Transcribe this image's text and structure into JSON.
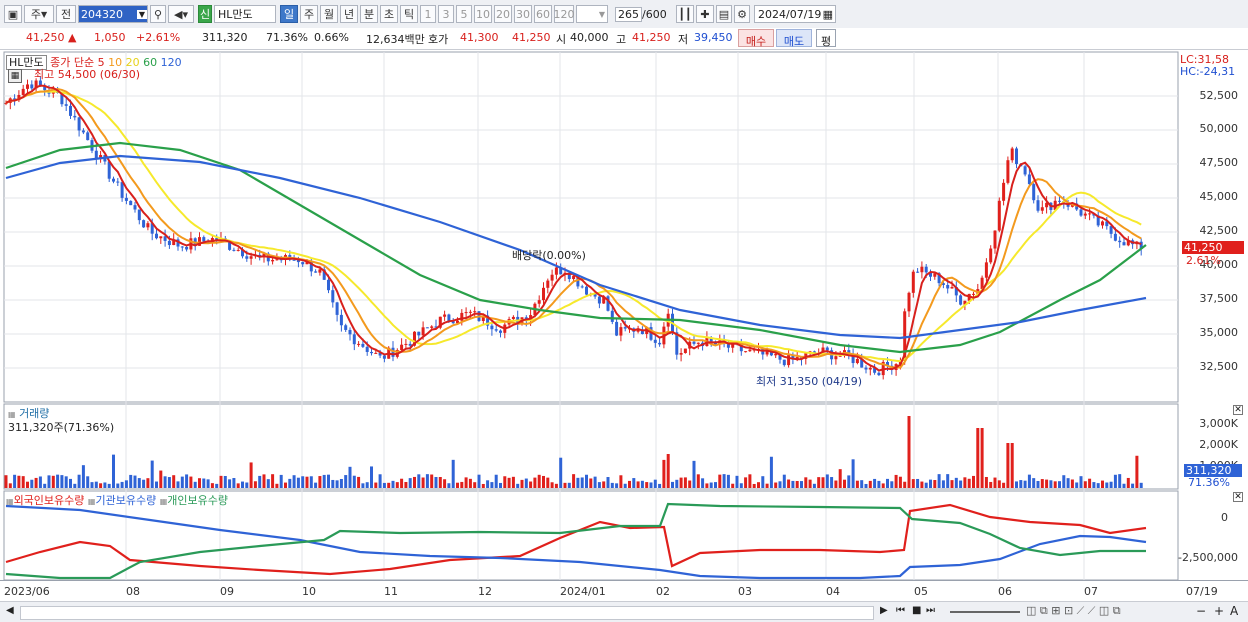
{
  "toolbar": {
    "period_sel": "주",
    "prev_label": "전",
    "stock_code": "204320",
    "new_badge": "신",
    "stock_name": "HL만도",
    "intervals": [
      "일",
      "주",
      "월",
      "년",
      "분",
      "초",
      "틱"
    ],
    "minutes": [
      "1",
      "3",
      "5",
      "10",
      "20",
      "30",
      "60",
      "120"
    ],
    "count_current": "265",
    "count_total": "/600",
    "date": "2024/07/19"
  },
  "quote": {
    "price": "41,250",
    "change": "1,050",
    "change_pct": "+2.61%",
    "volume": "311,320",
    "volume_ratio": "71.36%",
    "turnover": "0.66%",
    "trade_value": "12,634백만",
    "bid_label": "호가",
    "ask": "41,300",
    "bid": "41,250",
    "open_label": "시",
    "open": "40,000",
    "high_label": "고",
    "high": "41,250",
    "low_label": "저",
    "low": "39,450",
    "buy_label": "매수",
    "sell_label": "매도",
    "eval_label": "평"
  },
  "price_panel": {
    "name_tag": "HL만도",
    "ma_title": "종가 단순",
    "ma_periods": [
      "5",
      "10",
      "20",
      "60",
      "120"
    ],
    "ma_colors": [
      "#d8201c",
      "#f39a1e",
      "#f6e92c",
      "#2aa04a",
      "#2f63d6"
    ],
    "lc": "LC:31,58",
    "hc": "HC:-24,31",
    "high_note": "최고 54,500 (06/30)",
    "low_note": "최저 31,350 (04/19)",
    "dividend_note": "배당락(0.00%)",
    "current_price_tag": "41,250",
    "current_pct_tag": "2.61%",
    "y_labels": [
      "52,500",
      "50,000",
      "47,500",
      "45,000",
      "42,500",
      "40,000",
      "37,500",
      "35,000",
      "32,500"
    ]
  },
  "volume_panel": {
    "title": "거래량",
    "value": "311,320주(71.36%)",
    "y_labels": [
      "3,000K",
      "2,000K",
      "1,000K"
    ],
    "tag_value": "311,320",
    "tag_pct": "71.36%"
  },
  "holding_panel": {
    "series": [
      "외국인보유수량",
      "기관보유수량",
      "개인보유수량"
    ],
    "colors": [
      "#e0201c",
      "#2f63d6",
      "#2a9a58"
    ],
    "y_labels": [
      "0",
      "-2,500,000"
    ]
  },
  "x_axis": [
    "2023/06",
    "08",
    "09",
    "10",
    "11",
    "12",
    "2024/01",
    "02",
    "03",
    "04",
    "05",
    "06",
    "07",
    "07/19"
  ],
  "chart_data": {
    "type": "line",
    "title": "HL만도",
    "ylim": [
      31350,
      54500
    ],
    "x": [
      "2023/06",
      "08",
      "09",
      "10",
      "11",
      "12",
      "2024/01",
      "02",
      "03",
      "04",
      "05",
      "06",
      "07",
      "07/19"
    ],
    "series": [
      {
        "name": "종가",
        "values": [
          52000,
          47000,
          42500,
          40500,
          33500,
          36000,
          39500,
          35500,
          34000,
          33000,
          38000,
          46000,
          44000,
          41250
        ]
      },
      {
        "name": "120",
        "values": [
          47000,
          48000,
          47500,
          46500,
          44500,
          42500,
          40500,
          38500,
          36500,
          35000,
          35000,
          36500,
          37000,
          37500
        ]
      }
    ]
  }
}
